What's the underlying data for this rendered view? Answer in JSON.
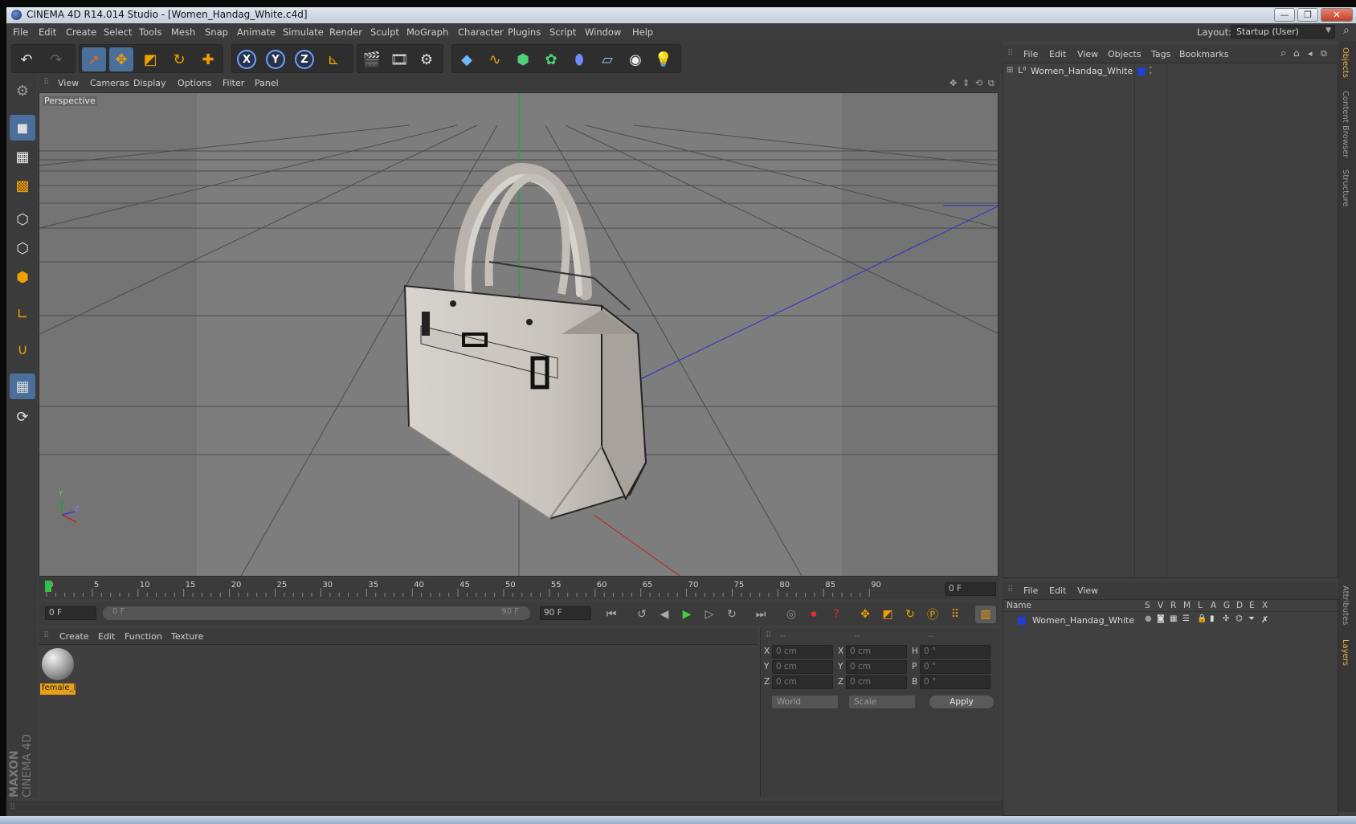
{
  "window": {
    "title": "CINEMA 4D R14.014 Studio - [Women_Handag_White.c4d]",
    "buttons": [
      "—",
      "❐",
      "✕"
    ]
  },
  "menu": [
    "File",
    "Edit",
    "Create",
    "Select",
    "Tools",
    "Mesh",
    "Snap",
    "Animate",
    "Simulate",
    "Render",
    "Sculpt",
    "MoGraph",
    "Character",
    "Plugins",
    "Script",
    "Window",
    "Help"
  ],
  "layout": {
    "label": "Layout:",
    "value": "Startup (User)"
  },
  "toolbar": {
    "axes": [
      "X",
      "Y",
      "Z"
    ]
  },
  "viewport": {
    "menu": [
      "View",
      "Cameras",
      "Display",
      "Options",
      "Filter",
      "Panel"
    ],
    "label": "Perspective",
    "gizmo": {
      "y": "Y",
      "z": "Z"
    }
  },
  "timeline": {
    "ticks": [
      "0",
      "5",
      "10",
      "15",
      "20",
      "25",
      "30",
      "35",
      "40",
      "45",
      "50",
      "55",
      "60",
      "65",
      "70",
      "75",
      "80",
      "85",
      "90"
    ],
    "current_frame": "0 F",
    "start_field": "0 F",
    "range_start": "0 F",
    "range_end": "90 F",
    "end_field": "90 F"
  },
  "materials": {
    "menu": [
      "Create",
      "Edit",
      "Function",
      "Texture"
    ],
    "items": [
      {
        "name": "female_l"
      }
    ]
  },
  "coords": {
    "headers": [
      "--",
      "--",
      "--"
    ],
    "rows": [
      {
        "a": "X",
        "av": "0 cm",
        "b": "X",
        "bv": "0 cm",
        "c": "H",
        "cv": "0 °"
      },
      {
        "a": "Y",
        "av": "0 cm",
        "b": "Y",
        "bv": "0 cm",
        "c": "P",
        "cv": "0 °"
      },
      {
        "a": "Z",
        "av": "0 cm",
        "b": "Z",
        "bv": "0 cm",
        "c": "B",
        "cv": "0 °"
      }
    ],
    "mode": "World",
    "scale": "Scale",
    "apply": "Apply"
  },
  "objects": {
    "menu": [
      "File",
      "Edit",
      "View",
      "Objects",
      "Tags",
      "Bookmarks"
    ],
    "tree": [
      {
        "name": "Women_Handag_White",
        "color": "#1f3fd0"
      }
    ]
  },
  "layers": {
    "menu": [
      "File",
      "Edit",
      "View"
    ],
    "columns": [
      "Name",
      "S",
      "V",
      "R",
      "M",
      "L",
      "A",
      "G",
      "D",
      "E",
      "X"
    ],
    "rows": [
      {
        "name": "Women_Handag_White",
        "color": "#1f3fd0"
      }
    ]
  },
  "side_tabs": [
    "Objects",
    "Content Browser",
    "Structure",
    "Attributes",
    "Layers"
  ],
  "brand": {
    "line1": "MAXON",
    "line2": "CINEMA 4D"
  }
}
